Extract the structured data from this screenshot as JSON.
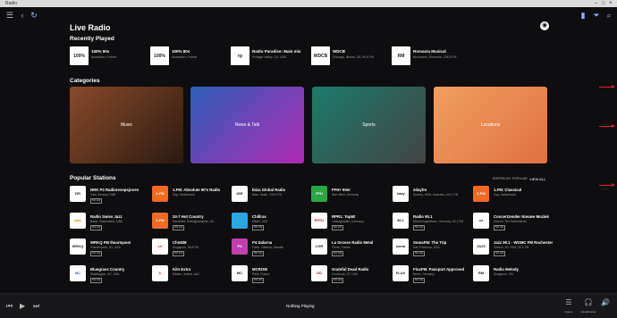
{
  "window": {
    "title": "Radio"
  },
  "header": {
    "title": "Live Radio"
  },
  "sections": {
    "recently_played": "Recently Played",
    "categories": "Categories",
    "popular": "Popular Stations"
  },
  "recently_played": [
    {
      "name": "100% 90s",
      "sub": "Australian, France",
      "logo": "100%"
    },
    {
      "name": "100% 80s",
      "sub": "Australian, France",
      "logo": "100%"
    },
    {
      "name": "Radio Paradise: Main mix",
      "sub": "Portage Valley, CA, USA",
      "logo": "rp"
    },
    {
      "name": "WDCB",
      "sub": "Chicago, Illinois, US, 90.9 FM",
      "logo": "WDCB"
    },
    {
      "name": "Romania Musical",
      "sub": "Bucharest, Romania, 106.8 FM",
      "logo": "RM"
    }
  ],
  "categories": [
    {
      "label": "Music",
      "color1": "#8a4a2a",
      "color2": "#2a1a10"
    },
    {
      "label": "News & Talk",
      "color1": "#2d5fb8",
      "color2": "#b12ab4"
    },
    {
      "label": "Sports",
      "color1": "#1c7a6a",
      "color2": "#444444"
    },
    {
      "label": "Locations",
      "color1": "#f0a060",
      "color2": "#e07040"
    }
  ],
  "sort": {
    "label": "SORTED BY: POPULAR",
    "view_all": "VIEW ALL"
  },
  "stations": [
    [
      {
        "name": "NRK P3 Radioresepsjonen",
        "sub": "Oslo, Norway, DAB",
        "logo": "RR",
        "bg": "#ffffff",
        "fg": "#222222",
        "badge": "NO HQ"
      },
      {
        "name": "Radio Swiss Jazz",
        "sub": "Basel, Switzerland, DAB",
        "logo": "jazz",
        "bg": "#ffffff",
        "fg": "#e08800",
        "badge": "NO HQ"
      },
      {
        "name": "WRKQ FM Iheartquest",
        "sub": "Grandequest, NY, USA",
        "logo": "WRKQ",
        "bg": "#ffffff",
        "fg": "#222222",
        "badge": "NO HQ"
      },
      {
        "name": "Bluegrass Country",
        "sub": "Washington, DC, USA",
        "logo": "BC",
        "bg": "#ffffff",
        "fg": "#3355aa",
        "badge": "NO HQ"
      }
    ],
    [
      {
        "name": "1.FM: Absolute 90's Radio",
        "sub": "Zug, Switzerland",
        "logo": "1.FM",
        "bg": "#f26a21",
        "fg": "#ffffff",
        "badge": ""
      },
      {
        "name": "24-7 Hot Country",
        "sub": "Mansfield, Nottinghamshire, UK",
        "logo": "1.FM",
        "bg": "#f26a21",
        "fg": "#ffffff",
        "badge": "NO HQ"
      },
      {
        "name": "Chn838",
        "sub": "Singapore, 95.8 FM",
        "logo": "cn",
        "bg": "#ffffff",
        "fg": "#d22222",
        "badge": "NO HQ"
      },
      {
        "name": "Kiln Extra",
        "sub": "Kildare, Ireland, AAC",
        "logo": "k",
        "bg": "#ffffff",
        "fg": "#d22222",
        "badge": ""
      }
    ],
    [
      {
        "name": "Ibiza Global Radio",
        "sub": "Ibiza, Spain, 105.8 FM",
        "logo": "IGR",
        "bg": "#ffffff",
        "fg": "#222222",
        "badge": ""
      },
      {
        "name": "Chillrax",
        "sub": "Miami, USA",
        "logo": "",
        "bg": "#2aa6e0",
        "fg": "#ffffff",
        "badge": "NO HQ"
      },
      {
        "name": "P4 Dalarna",
        "sub": "Falun, Dalarna, Sweden",
        "logo": "P4",
        "bg": "#c040b0",
        "fg": "#ffffff",
        "badge": "NO HQ"
      },
      {
        "name": "MCROW",
        "sub": "Paris, France",
        "logo": "MC",
        "bg": "#ffffff",
        "fg": "#222222",
        "badge": "NO HQ"
      }
    ],
    [
      {
        "name": "FFH+ 90er",
        "sub": "Bad Vilbel, Germany",
        "logo": "FFH",
        "bg": "#27a844",
        "fg": "#ffffff",
        "badge": ""
      },
      {
        "name": "RPR1: Top50",
        "sub": "Ludwigshafen, Germany",
        "logo": "RPR1",
        "bg": "#ffffff",
        "fg": "#d22222",
        "badge": "NO HQ"
      },
      {
        "name": "La Grosse Radio Metal",
        "sub": "Pierre, France",
        "logo": "LGR",
        "bg": "#ffffff",
        "fg": "#222222",
        "badge": "NO HQ"
      },
      {
        "name": "Grateful Dead Radio",
        "sub": "Cincinnati, OT, USA",
        "logo": "GD",
        "bg": "#ffffff",
        "fg": "#aa2222",
        "badge": "NO HQ"
      }
    ],
    [
      {
        "name": "2dayfm",
        "sub": "Sydney, NSW, Australia, 104.1 FM",
        "logo": "2day",
        "bg": "#ffffff",
        "fg": "#222222",
        "badge": ""
      },
      {
        "name": "Radio 90.1",
        "sub": "Mönchengladbach, Germany, 90.1 FM",
        "logo": "90.1",
        "bg": "#ffffff",
        "fg": "#222222",
        "badge": "NO HQ"
      },
      {
        "name": "SomaFM: The Trip",
        "sub": "San Francisco, USA",
        "logo": "soma",
        "bg": "#ffffff",
        "fg": "#222222",
        "badge": "NO HQ"
      },
      {
        "name": "FluxFM: Passport Approved",
        "sub": "Berlin, Germany",
        "logo": "FLUX",
        "bg": "#ffffff",
        "fg": "#222222",
        "badge": "NO HQ"
      }
    ],
    [
      {
        "name": "1.FM: Classical",
        "sub": "Zug, Switzerland",
        "logo": "1.FM",
        "bg": "#f26a21",
        "fg": "#ffffff",
        "badge": ""
      },
      {
        "name": "Concertzender Nieuwe Muziek",
        "sub": "Utrecht, The Netherlands",
        "logo": "cz",
        "bg": "#ffffff",
        "fg": "#222222",
        "badge": "NO HQ"
      },
      {
        "name": "Jazz 90.1 - WGMC FM Rochester",
        "sub": "Greece, NY, USA, 90.1 FM",
        "logo": "JAZZ",
        "bg": "#ffffff",
        "fg": "#222222",
        "badge": "NO HQ"
      },
      {
        "name": "Radio Melody",
        "sub": "Singapore, FM",
        "logo": "RM",
        "bg": "#ffffff",
        "fg": "#222222",
        "badge": ""
      }
    ]
  ],
  "player": {
    "now_playing": "Nothing Playing",
    "queue_label": "Queue",
    "headphones_label": "Headphones"
  }
}
